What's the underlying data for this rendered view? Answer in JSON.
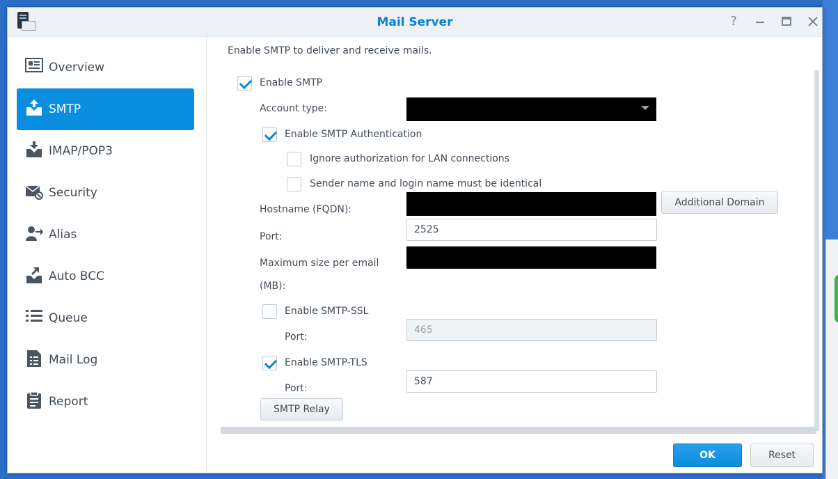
{
  "window": {
    "title": "Mail Server"
  },
  "titlebar_buttons": [
    "help-icon",
    "minimize-icon",
    "maximize-icon",
    "close-icon"
  ],
  "sidebar": {
    "items": [
      {
        "label": "Overview",
        "icon": "overview-icon"
      },
      {
        "label": "SMTP",
        "icon": "smtp-icon",
        "active": true
      },
      {
        "label": "IMAP/POP3",
        "icon": "imap-icon"
      },
      {
        "label": "Security",
        "icon": "security-icon"
      },
      {
        "label": "Alias",
        "icon": "alias-icon"
      },
      {
        "label": "Auto BCC",
        "icon": "auto-bcc-icon"
      },
      {
        "label": "Queue",
        "icon": "queue-icon"
      },
      {
        "label": "Mail Log",
        "icon": "mail-log-icon"
      },
      {
        "label": "Report",
        "icon": "report-icon"
      }
    ]
  },
  "smtp": {
    "description": "Enable SMTP to deliver and receive mails.",
    "enable_smtp": {
      "label": "Enable SMTP",
      "checked": true
    },
    "account_type": {
      "label": "Account type:"
    },
    "enable_auth": {
      "label": "Enable SMTP Authentication",
      "checked": true
    },
    "ignore_lan": {
      "label": "Ignore authorization for LAN connections",
      "checked": false
    },
    "sender_identical": {
      "label": "Sender name and login name must be identical",
      "checked": false
    },
    "hostname": {
      "label": "Hostname (FQDN):"
    },
    "additional_domain_button": "Additional Domain",
    "port": {
      "label": "Port:",
      "value": "2525"
    },
    "max_size": {
      "label_line1": "Maximum size per email",
      "label_line2": "(MB):"
    },
    "ssl": {
      "label": "Enable SMTP-SSL",
      "checked": false,
      "port_label": "Port:",
      "port_value": "465"
    },
    "tls": {
      "label": "Enable SMTP-TLS",
      "checked": true,
      "port_label": "Port:",
      "port_value": "587"
    },
    "relay_button": "SMTP Relay"
  },
  "footer": {
    "ok": "OK",
    "reset": "Reset"
  },
  "colors": {
    "accent": "#0a8ee0",
    "title": "#0b7fd1",
    "desktop": "#2c6fc9"
  }
}
